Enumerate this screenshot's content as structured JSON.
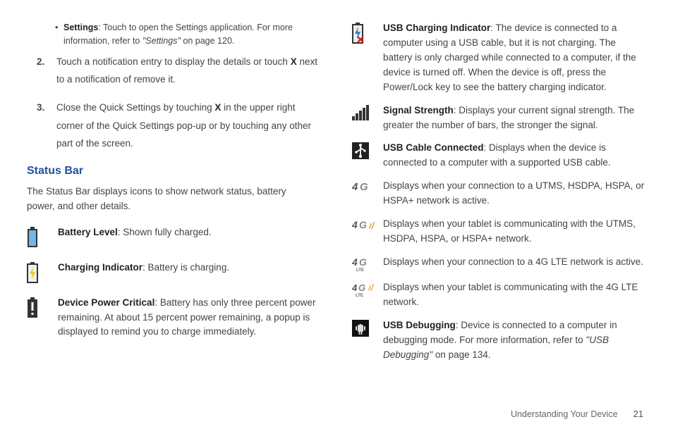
{
  "col1": {
    "bullet": {
      "label": "Settings",
      "text1": ": Touch to open the Settings application. For more information, refer to ",
      "ref": "\"Settings\"",
      "text2": "  on page 120."
    },
    "step2": {
      "num": "2.",
      "text1": "Touch a notification entry to display the details or touch ",
      "x": "X",
      "text2": " next to a notification of remove it."
    },
    "step3": {
      "num": "3.",
      "text1": "Close the Quick Settings by touching ",
      "x": "X",
      "text2": " in the upper right corner of the Quick Settings pop-up or by touching any other part of the screen."
    },
    "heading": "Status Bar",
    "intro": "The Status Bar displays icons to show network status, battery power, and other details.",
    "items": [
      {
        "label": "Battery Level",
        "text": ": Shown fully charged."
      },
      {
        "label": "Charging Indicator",
        "text": ": Battery is charging."
      },
      {
        "label": "Device Power Critical",
        "text": ": Battery has only three percent power remaining. At about 15 percent power remaining, a popup is displayed to remind you to charge immediately."
      }
    ]
  },
  "col2": {
    "items": [
      {
        "label": "USB Charging Indicator",
        "text": ": The device is connected to a computer using a USB cable, but it is not charging. The battery is only charged while connected to a computer, if the device is turned off. When the device is off, press the Power/Lock key to see the battery charging indicator."
      },
      {
        "label": "Signal Strength",
        "text": ": Displays your current signal strength. The greater the number of bars, the stronger the signal."
      },
      {
        "label": "USB Cable Connected",
        "text": ": Displays when the device is connected to a computer with a supported USB cable."
      },
      {
        "label": "",
        "text": "Displays when your connection to a UTMS, HSDPA, HSPA, or HSPA+ network is active."
      },
      {
        "label": "",
        "text": "Displays when your tablet is communicating with the UTMS, HSDPA, HSPA, or HSPA+ network."
      },
      {
        "label": "",
        "text": "Displays when your connection to a 4G LTE network is active."
      },
      {
        "label": "",
        "text": "Displays when your tablet is communicating with the 4G LTE network."
      },
      {
        "label": "USB Debugging",
        "text1": ": Device is connected to a computer in debugging mode. For more information, refer to ",
        "ref": "\"USB Debugging\"",
        "text2": "  on page 134."
      }
    ]
  },
  "footer": {
    "section": "Understanding Your Device",
    "page": "21"
  }
}
